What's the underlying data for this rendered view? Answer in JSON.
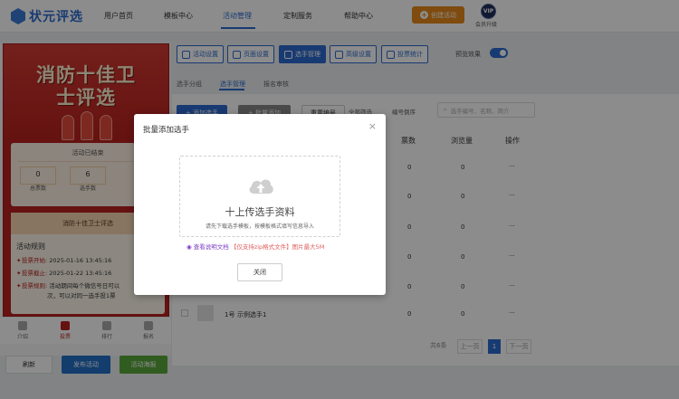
{
  "app": {
    "logo_text": "状元评选"
  },
  "nav": {
    "items": [
      "用户首页",
      "模板中心",
      "活动管理",
      "定制服务",
      "帮助中心"
    ],
    "create_label": "创建活动",
    "vip_badge": "VIP",
    "vip_label": "会员升级"
  },
  "preview": {
    "title_line1": "消防十佳卫",
    "title_line2": "士评选",
    "status": "活动已结束",
    "stats": [
      {
        "value": "0",
        "label": "总票数"
      },
      {
        "value": "6",
        "label": "选手数"
      },
      {
        "value": "0",
        "label": "访"
      }
    ],
    "banner": "消防十佳卫士评选",
    "rules_title": "活动规则",
    "rules": [
      {
        "key": "投票开始:",
        "text": "2025-01-16 13:45:16"
      },
      {
        "key": "投票截止:",
        "text": "2025-01-22 13:45:16"
      },
      {
        "key": "投票规则:",
        "text": "活动期间每个微信号日可以"
      },
      {
        "key": "",
        "text": "次，可以对同一选手投1票"
      }
    ],
    "tabs": [
      "介绍",
      "投票",
      "排行",
      "报名"
    ],
    "active_tab": 1
  },
  "left_buttons": {
    "refresh": "刷新",
    "publish": "发布活动",
    "poster": "活动海报"
  },
  "toolbar": {
    "buttons": [
      "活动设置",
      "页面设置",
      "选手管理",
      "高级设置",
      "投票统计"
    ],
    "active": 2,
    "preview_label": "预览效果",
    "preview_on": true
  },
  "subtabs": {
    "items": [
      "选手分组",
      "选手管理",
      "报名审核"
    ],
    "active": 1
  },
  "actions": {
    "add": "+ 添加选手",
    "batch_add": "+ 批量添加",
    "reset_no": "重置编号",
    "all_filter": "全部筛选",
    "sort": "编号倒序",
    "search_placeholder": "选手编号、名称、简介"
  },
  "table": {
    "headers": [
      "票数",
      "浏览量",
      "操作"
    ],
    "rows": [
      {
        "votes": "0",
        "views": "0",
        "op": "···"
      },
      {
        "votes": "0",
        "views": "0",
        "op": "···"
      },
      {
        "votes": "0",
        "views": "0",
        "op": "···"
      },
      {
        "votes": "0",
        "views": "0",
        "op": "···"
      },
      {
        "votes": "0",
        "views": "0",
        "op": "···"
      },
      {
        "no": "1号",
        "name": "示例选手1",
        "votes": "0",
        "views": "0",
        "op": "···"
      }
    ]
  },
  "pager": {
    "total": "共6条",
    "prev": "上一页",
    "current": "1",
    "next": "下一页"
  },
  "modal": {
    "title": "批量添加选手",
    "close": "×",
    "upload_label": "十上传选手资料",
    "upload_hint": "请先下载选手模板，按模板格式填写信息导入",
    "doc_link": "查看说明文档",
    "doc_note": "【仅支持zip格式文件】图片最大5M",
    "close_button": "关闭"
  },
  "colors": {
    "brand": "#2d6bd0",
    "create": "#e8891b",
    "poster_red": "#b8221f",
    "publish": "#2170c7",
    "poster_btn": "#5aa83b"
  }
}
